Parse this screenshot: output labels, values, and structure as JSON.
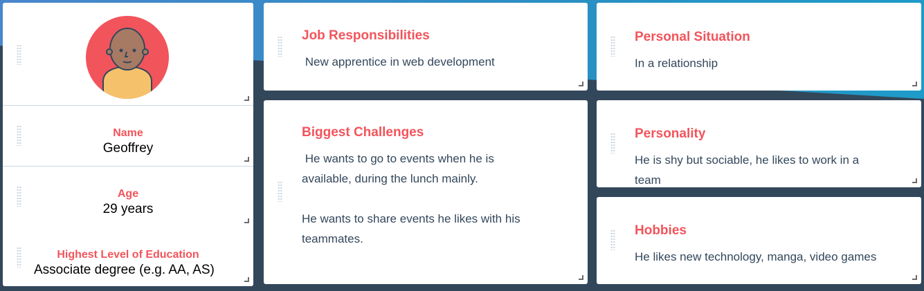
{
  "colors": {
    "accent": "#f2545b",
    "background": "#33475b",
    "text": "#33475b"
  },
  "profile": {
    "avatar_icon": "person-avatar",
    "name": {
      "label": "Name",
      "value": "Geoffrey"
    },
    "age": {
      "label": "Age",
      "value": "29 years"
    },
    "education": {
      "label": "Highest Level of Education",
      "value": "Associate degree (e.g. AA, AS)"
    }
  },
  "cards": {
    "job": {
      "title": "Job Responsibilities",
      "body": " New apprentice in web development"
    },
    "challenges": {
      "title": "Biggest Challenges",
      "body": " He wants to go to events when he is available, during the lunch mainly.\n\nHe wants to share events he likes with his teammates."
    },
    "situation": {
      "title": "Personal Situation",
      "body": "In a relationship"
    },
    "personality": {
      "title": "Personality",
      "body": "He is shy but sociable, he likes to work in a team"
    },
    "hobbies": {
      "title": "Hobbies",
      "body": "He likes new technology, manga, video games"
    }
  }
}
